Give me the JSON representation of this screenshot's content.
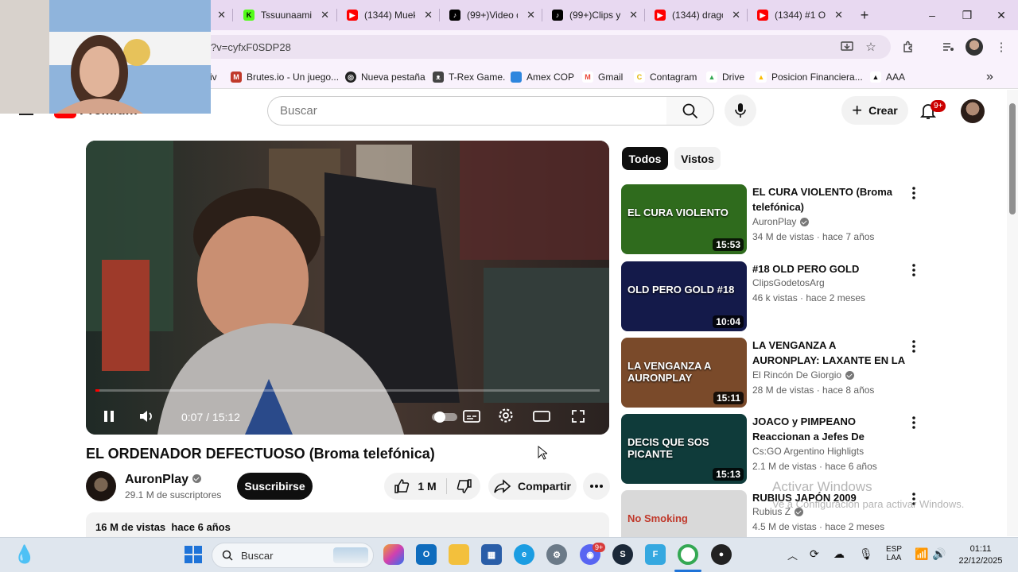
{
  "browser": {
    "tabs": [
      {
        "title": "",
        "kind": "active",
        "icon": "close-icon"
      },
      {
        "title": "Tssuunaamii",
        "icon": "kick-icon",
        "color": "#53fc18"
      },
      {
        "title": "(1344) Muek",
        "icon": "youtube-icon",
        "color": "#ff0000"
      },
      {
        "title": "(99+)Video d",
        "icon": "tiktok-icon",
        "color": "#000000"
      },
      {
        "title": "(99+)Clips y",
        "icon": "tiktok-icon",
        "color": "#000000"
      },
      {
        "title": "(1344) drago",
        "icon": "youtube-icon",
        "color": "#ff0000"
      },
      {
        "title": "(1344) #1 OL",
        "icon": "youtube-icon",
        "color": "#ff0000"
      }
    ],
    "new_tab": "+",
    "window": {
      "minimize": "–",
      "restore": "❐",
      "close": "✕"
    },
    "address": "?v=cyfxF0SDP28",
    "bookmarks": [
      {
        "label": "iv"
      },
      {
        "label": "Brutes.io - Un juego...",
        "color": "#c0392b"
      },
      {
        "label": "Nueva pestaña",
        "color": "#222222"
      },
      {
        "label": "T-Rex Game.",
        "color": "#444444"
      },
      {
        "label": "Amex COP",
        "color": "#2e86de"
      },
      {
        "label": "Gmail",
        "color": "#ea4335"
      },
      {
        "label": "Contagram",
        "color": "#f1c40f"
      },
      {
        "label": "Drive",
        "color": "#34a853"
      },
      {
        "label": "Posicion Financiera...",
        "color": "#fbbc04"
      },
      {
        "label": "AAA",
        "color": "#111111"
      }
    ],
    "bookmarks_more": "»"
  },
  "youtube": {
    "logo_text": "Premium",
    "search_placeholder": "Buscar",
    "create_label": "Crear",
    "notif_badge": "9+",
    "player": {
      "time": "0:07 / 15:12",
      "progress": 0.008
    },
    "video_title": "EL ORDENADOR DEFECTUOSO (Broma telefónica)",
    "channel": {
      "name": "AuronPlay",
      "subs": "29.1 M de suscriptores"
    },
    "subscribe_label": "Suscribirse",
    "likes": "1 M",
    "share_label": "Compartir",
    "description": {
      "views": "16 M de vistas",
      "age": "hace 6 años"
    },
    "chips": [
      "Todos",
      "Vistos"
    ],
    "recommendations": [
      {
        "title": "EL CURA VIOLENTO (Broma telefónica)",
        "channel": "AuronPlay",
        "verified": true,
        "meta": "34 M de vistas · hace 7 años",
        "duration": "15:53",
        "thumb_text": "EL CURA VIOLENTO",
        "thumb_bg": "#2f6b1d"
      },
      {
        "title": "#18 OLD PERO GOLD",
        "channel": "ClipsGodetosArg",
        "verified": false,
        "meta": "46 k vistas · hace 2 meses",
        "duration": "10:04",
        "thumb_text": "OLD PERO GOLD #18",
        "thumb_bg": "#141a4a"
      },
      {
        "title": "LA VENGANZA A AURONPLAY: LAXANTE EN LA COMIDA",
        "channel": "El Rincón De Giorgio",
        "verified": true,
        "meta": "28 M de vistas · hace 8 años",
        "duration": "15:11",
        "thumb_text": "LA VENGANZA A AURONPLAY",
        "thumb_bg": "#7a4a2a"
      },
      {
        "title": "JOACO y PIMPEANO Reaccionan a Jefes De Youtub…",
        "channel": "Cs:GO Argentino Highligts",
        "verified": false,
        "meta": "2.1 M de vistas · hace 6 años",
        "duration": "15:13",
        "thumb_text": "DECIS QUE SOS PICANTE",
        "thumb_bg": "#0f3b3a"
      },
      {
        "title": "RUBIUS JAPÓN 2009",
        "channel": "Rubius Z",
        "verified": true,
        "meta": "4.5 M de vistas · hace 2 meses",
        "duration": "",
        "thumb_text": "No Smoking",
        "thumb_bg": "#d9d9d9"
      }
    ]
  },
  "watermark": {
    "line1": "Activar Windows",
    "line2": "Ve a Configuración para activar Windows."
  },
  "taskbar": {
    "search_placeholder": "Buscar",
    "lang": "ESP",
    "region": "LAA",
    "time": "01:11",
    "date": "22/12/2025",
    "discord_badge": "9+"
  }
}
